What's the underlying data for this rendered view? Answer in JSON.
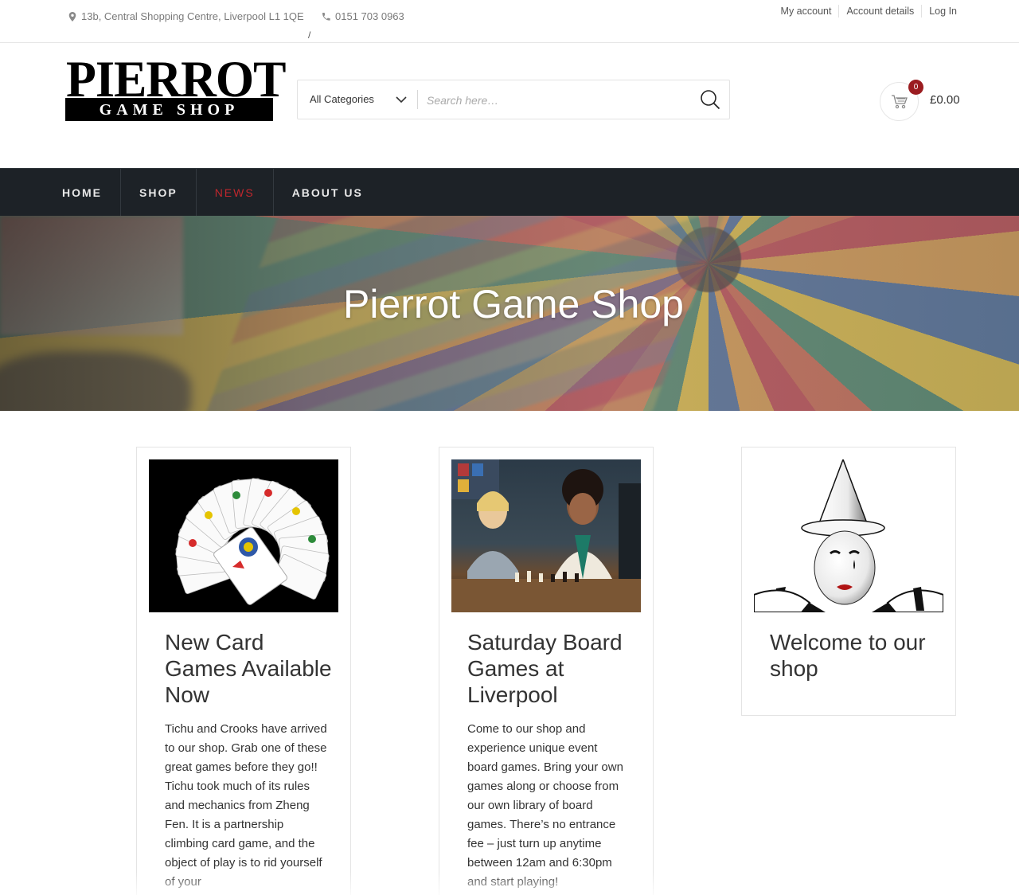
{
  "topbar": {
    "address": "13b, Central Shopping Centre, Liverpool L1 1QE",
    "phone": "0151 703 0963",
    "separator": "/",
    "links": [
      "My account",
      "Account details",
      "Log In"
    ]
  },
  "header": {
    "logo_line1": "PIERROT",
    "logo_line2": "GAME SHOP",
    "search": {
      "category": "All Categories",
      "placeholder": "Search here…"
    },
    "cart": {
      "count": "0",
      "total": "£0.00"
    }
  },
  "nav": {
    "items": [
      "HOME",
      "SHOP",
      "NEWS",
      "ABOUT US"
    ],
    "active": "NEWS"
  },
  "hero": {
    "title": "Pierrot Game Shop"
  },
  "posts": [
    {
      "title": "New Card Games Available Now",
      "excerpt": "Tichu and Crooks have arrived to our shop. Grab one of these great games before they go!! Tichu took much of its rules and mechanics from Zheng Fen. It is a partnership climbing card game, and the object of play is to rid yourself of your"
    },
    {
      "title": "Saturday Board Games at Liverpool",
      "excerpt": "Come to our shop and experience unique event board games. Bring your own games along or choose from our own library of board games. There’s no entrance fee – just turn up anytime between 12am and 6:30pm and start playing!"
    },
    {
      "title": "Welcome to our shop",
      "excerpt": ""
    }
  ],
  "colors": {
    "nav_bg": "#1d2227",
    "accent": "#c0272d",
    "badge": "#9b1c20"
  }
}
